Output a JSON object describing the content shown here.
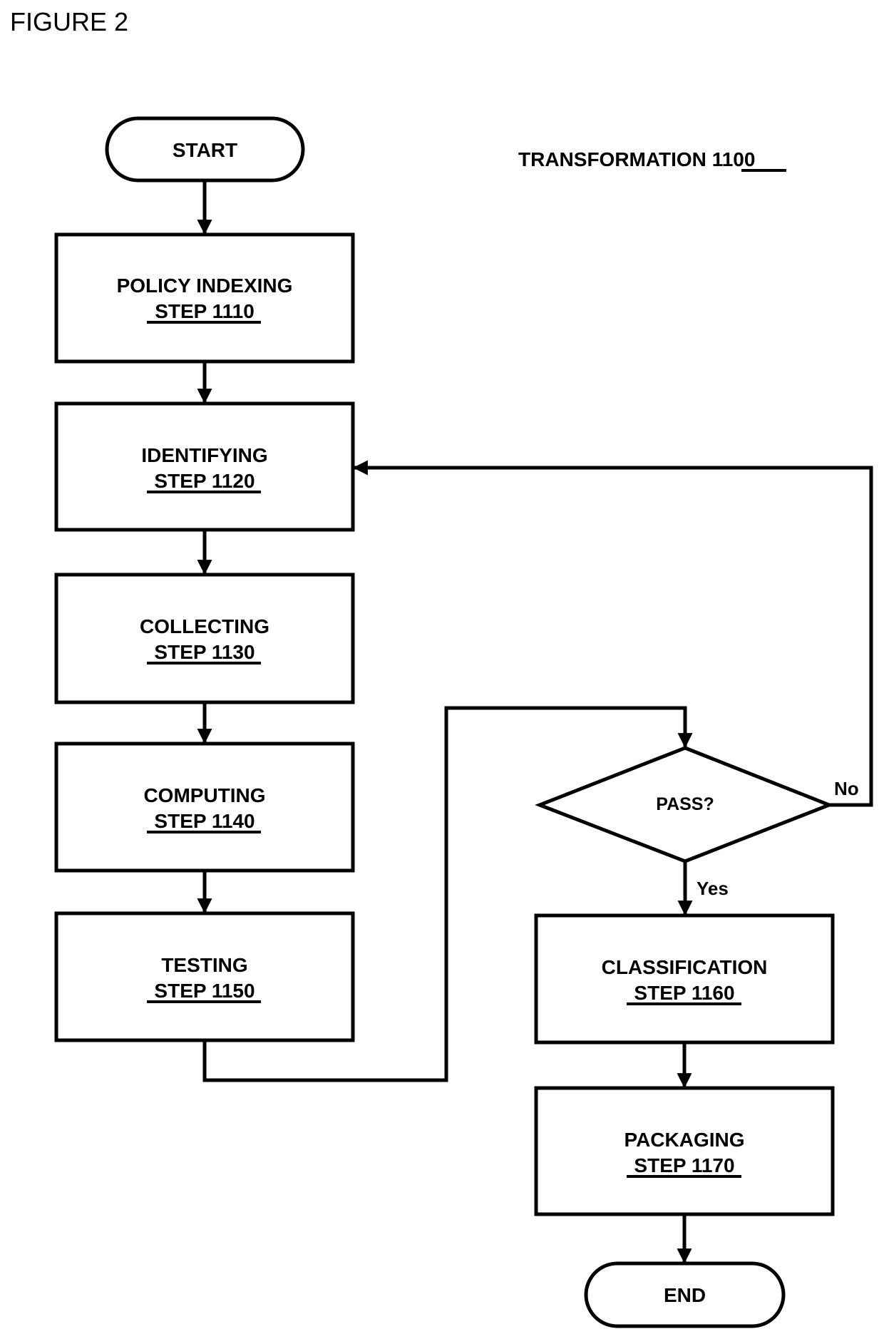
{
  "figure_label": "FIGURE 2",
  "title": {
    "text": "TRANSFORMATION ",
    "ref": "1100"
  },
  "nodes": {
    "start": {
      "label": "START",
      "shape": "terminator"
    },
    "policy_indexing": {
      "label": "POLICY INDEXING",
      "step": "STEP 1110",
      "shape": "process"
    },
    "identifying": {
      "label": "IDENTIFYING",
      "step": "STEP 1120",
      "shape": "process"
    },
    "collecting": {
      "label": "COLLECTING",
      "step": "STEP 1130",
      "shape": "process"
    },
    "computing": {
      "label": "COMPUTING",
      "step": "STEP 1140",
      "shape": "process"
    },
    "testing": {
      "label": "TESTING",
      "step": "STEP 1150",
      "shape": "process"
    },
    "pass": {
      "label": "PASS?",
      "shape": "decision"
    },
    "classification": {
      "label": "CLASSIFICATION",
      "step": "STEP 1160",
      "shape": "process"
    },
    "packaging": {
      "label": "PACKAGING",
      "step": "STEP 1170",
      "shape": "process"
    },
    "end": {
      "label": "END",
      "shape": "terminator"
    }
  },
  "edges": [
    {
      "from": "start",
      "to": "policy_indexing",
      "label": ""
    },
    {
      "from": "policy_indexing",
      "to": "identifying",
      "label": ""
    },
    {
      "from": "identifying",
      "to": "collecting",
      "label": ""
    },
    {
      "from": "collecting",
      "to": "computing",
      "label": ""
    },
    {
      "from": "computing",
      "to": "testing",
      "label": ""
    },
    {
      "from": "testing",
      "to": "pass",
      "label": ""
    },
    {
      "from": "pass",
      "to": "identifying",
      "label": "No"
    },
    {
      "from": "pass",
      "to": "classification",
      "label": "Yes"
    },
    {
      "from": "classification",
      "to": "packaging",
      "label": ""
    },
    {
      "from": "packaging",
      "to": "end",
      "label": ""
    }
  ],
  "branch_labels": {
    "no": "No",
    "yes": "Yes"
  }
}
